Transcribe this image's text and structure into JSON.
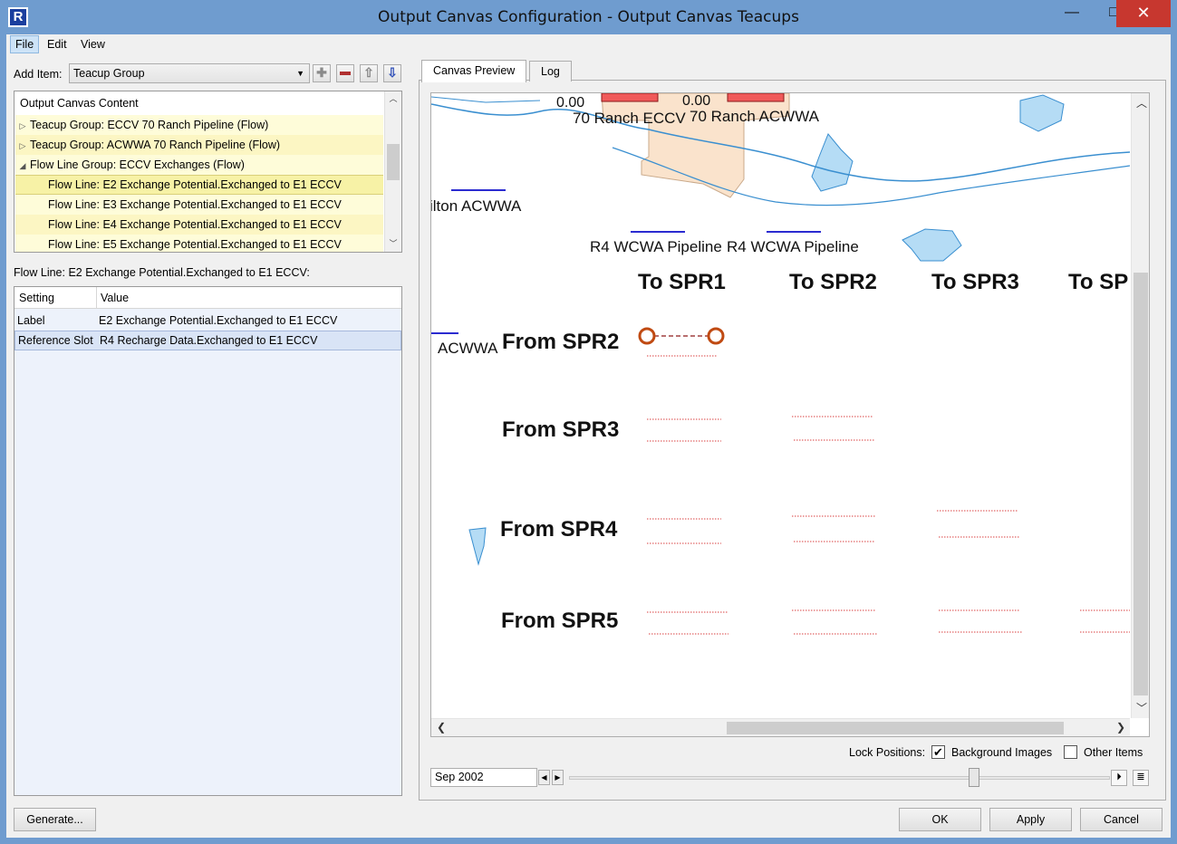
{
  "window": {
    "title": "Output Canvas Configuration - Output Canvas Teacups",
    "app_icon_letter": "R",
    "min_glyph": "—",
    "max_glyph": "□",
    "close_glyph": "✕"
  },
  "menu": [
    "File",
    "Edit",
    "View"
  ],
  "toolbar": {
    "add_item_label": "Add Item:",
    "add_item_value": "Teacup Group",
    "buttons": [
      "add",
      "remove",
      "move-up",
      "move-down"
    ]
  },
  "tree": {
    "header": "Output Canvas Content",
    "rows": [
      {
        "label": "Teacup Group: ECCV 70 Ranch Pipeline (Flow)",
        "expanded": false,
        "level": 0
      },
      {
        "label": "Teacup Group: ACWWA 70 Ranch Pipeline (Flow)",
        "expanded": false,
        "level": 0
      },
      {
        "label": "Flow Line Group: ECCV Exchanges (Flow)",
        "expanded": true,
        "level": 0
      },
      {
        "label": "Flow Line: E2 Exchange Potential.Exchanged to E1 ECCV",
        "level": 1,
        "selected": true
      },
      {
        "label": "Flow Line: E3 Exchange Potential.Exchanged to E1 ECCV",
        "level": 1
      },
      {
        "label": "Flow Line: E4 Exchange Potential.Exchanged to E1 ECCV",
        "level": 1
      },
      {
        "label": "Flow Line: E5 Exchange Potential.Exchanged to E1 ECCV",
        "level": 1
      }
    ]
  },
  "selected_item_label": "Flow Line: E2 Exchange Potential.Exchanged to E1 ECCV:",
  "settings": {
    "columns": [
      "Setting",
      "Value"
    ],
    "rows": [
      {
        "setting": "Label",
        "value": "E2 Exchange Potential.Exchanged to E1 ECCV"
      },
      {
        "setting": "Reference Slot",
        "value": "R4 Recharge Data.Exchanged to E1 ECCV"
      }
    ]
  },
  "tabs": [
    "Canvas Preview",
    "Log"
  ],
  "canvas": {
    "values": [
      "0.00",
      "0.00"
    ],
    "map_labels": [
      "70 Ranch ECCV",
      "70 Ranch ACWWA",
      "ilton ACWWA",
      "R4 WCWA Pipeline",
      "R4 WCWA Pipeline",
      "ACWWA"
    ],
    "to_labels": [
      "To SPR1",
      "To SPR2",
      "To SPR3",
      "To SP"
    ],
    "from_labels": [
      "From SPR2",
      "From SPR3",
      "From SPR4",
      "From SPR5"
    ],
    "colors": {
      "water": "#b5dcf5",
      "river": "#3a8fd0",
      "land": "#fae3cc",
      "teacup": "#f05a5a",
      "flow_dotted": "#d94040",
      "label_line": "#2b2bd0"
    }
  },
  "lock_positions": {
    "label": "Lock Positions:",
    "background_images": {
      "label": "Background Images",
      "checked": true
    },
    "other_items": {
      "label": "Other Items",
      "checked": false
    }
  },
  "timeline": {
    "date": "Sep 2002"
  },
  "buttons": {
    "generate": "Generate...",
    "ok": "OK",
    "apply": "Apply",
    "cancel": "Cancel"
  }
}
